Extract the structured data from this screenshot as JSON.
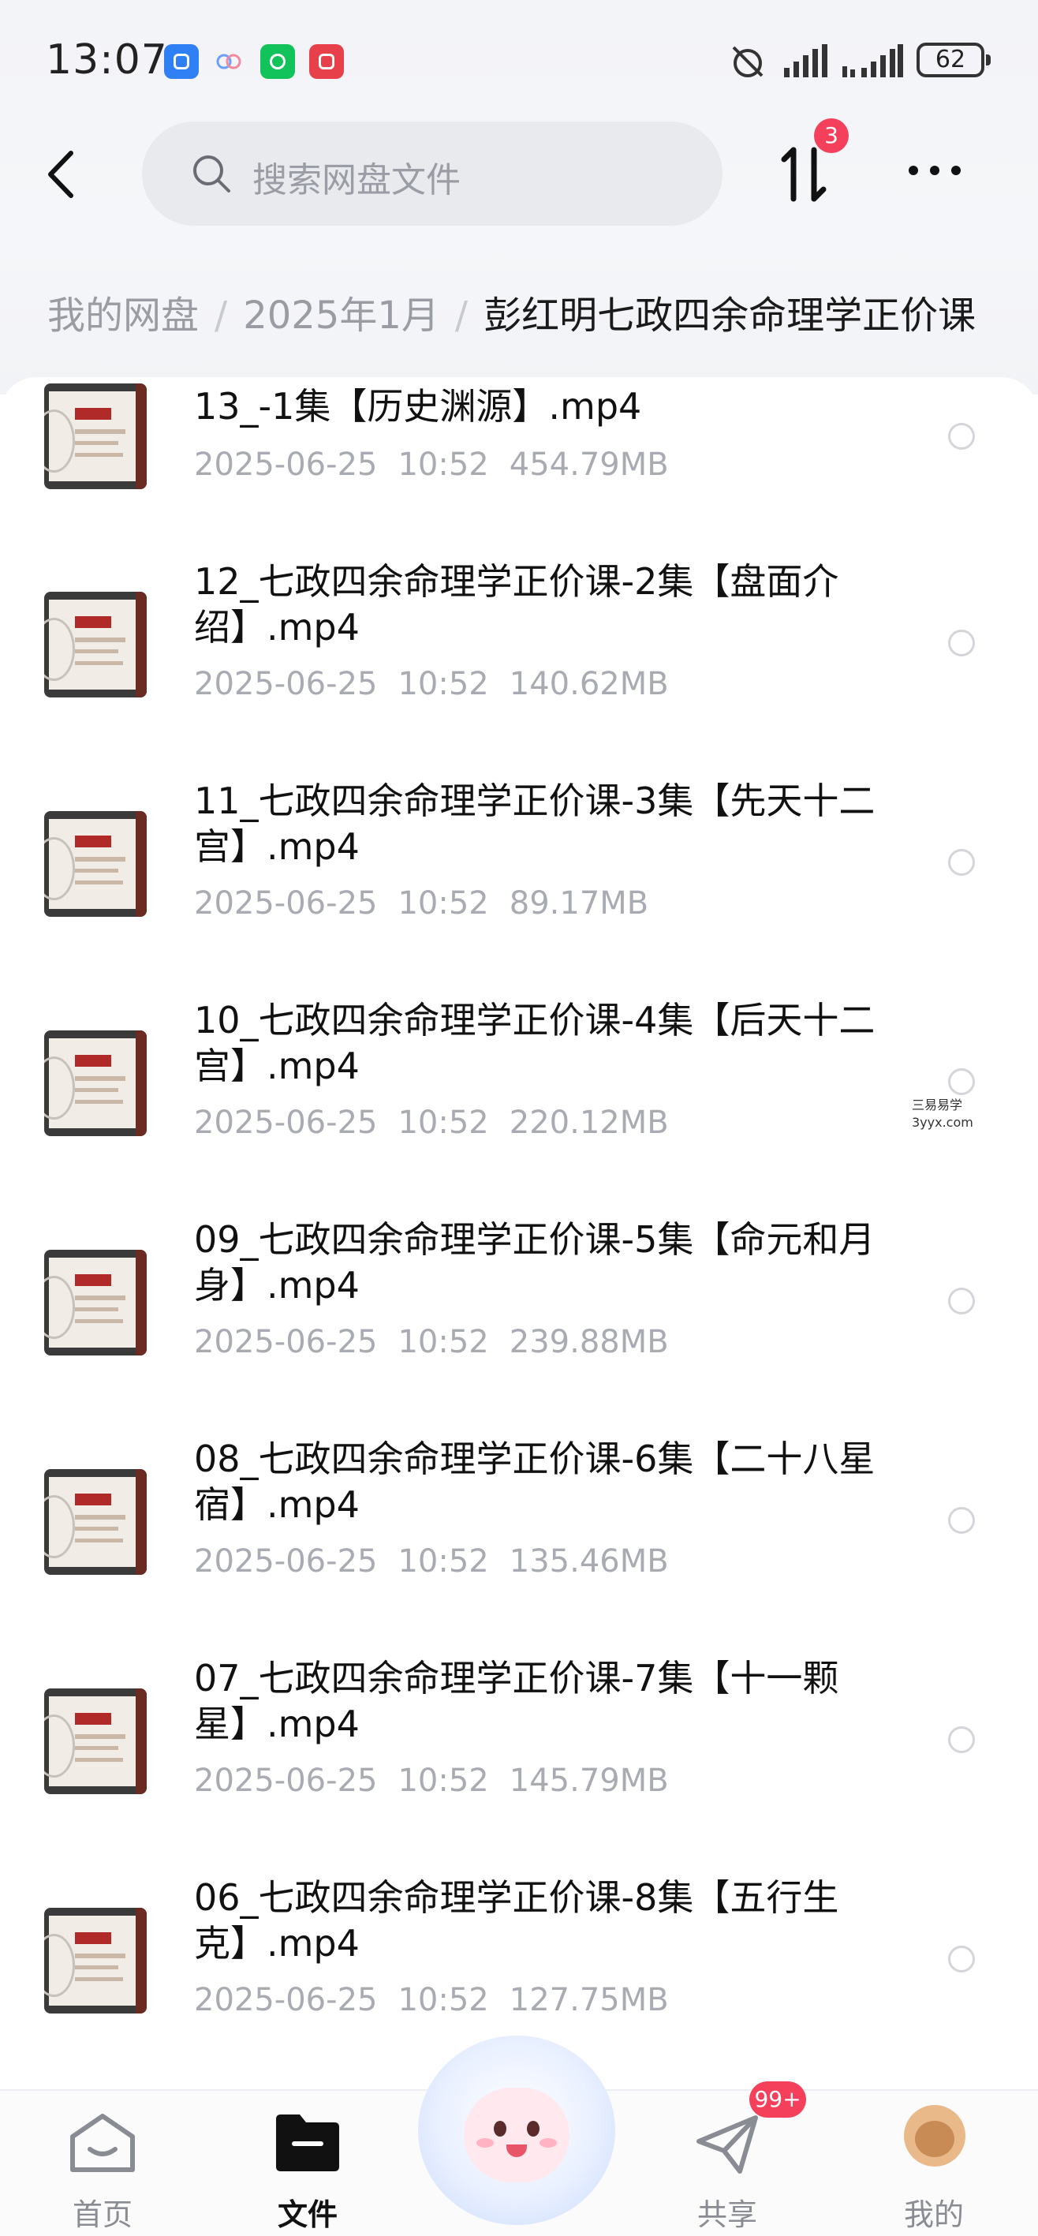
{
  "status_bar": {
    "time": "13:07",
    "battery": "62"
  },
  "header": {
    "search_placeholder": "搜索网盘文件",
    "transfer_badge": "3"
  },
  "breadcrumb": {
    "items": [
      "我的网盘",
      "2025年1月"
    ],
    "current": "彭红明七政四余命理学正价课"
  },
  "files": [
    {
      "name": "13_-1集【历史渊源】.mp4",
      "date": "2025-06-25",
      "time": "10:52",
      "size": "454.79MB"
    },
    {
      "name": "12_七政四余命理学正价课-2集【盘面介绍】.mp4",
      "date": "2025-06-25",
      "time": "10:52",
      "size": "140.62MB"
    },
    {
      "name": "11_七政四余命理学正价课-3集【先天十二宫】.mp4",
      "date": "2025-06-25",
      "time": "10:52",
      "size": "89.17MB"
    },
    {
      "name": "10_七政四余命理学正价课-4集【后天十二宫】.mp4",
      "date": "2025-06-25",
      "time": "10:52",
      "size": "220.12MB"
    },
    {
      "name": "09_七政四余命理学正价课-5集【命元和月身】.mp4",
      "date": "2025-06-25",
      "time": "10:52",
      "size": "239.88MB"
    },
    {
      "name": "08_七政四余命理学正价课-6集【二十八星宿】.mp4",
      "date": "2025-06-25",
      "time": "10:52",
      "size": "135.46MB"
    },
    {
      "name": "07_七政四余命理学正价课-7集【十一颗星】.mp4",
      "date": "2025-06-25",
      "time": "10:52",
      "size": "145.79MB"
    },
    {
      "name": "06_七政四余命理学正价课-8集【五行生克】.mp4",
      "date": "2025-06-25",
      "time": "10:52",
      "size": "127.75MB"
    }
  ],
  "watermark": {
    "line1": "三易易学",
    "line2": "3yyx.com"
  },
  "bottom_nav": {
    "tabs": [
      {
        "label": "首页",
        "icon": "home-icon"
      },
      {
        "label": "文件",
        "icon": "folder-icon",
        "active": true
      },
      {
        "label": "共享",
        "icon": "share-plane-icon",
        "badge": "99+"
      },
      {
        "label": "我的",
        "icon": "avatar"
      }
    ]
  },
  "colors": {
    "accent": "#f4405a",
    "text_primary": "#111111",
    "text_secondary": "#a9abb2",
    "page_bg": "#f3f4f7"
  }
}
